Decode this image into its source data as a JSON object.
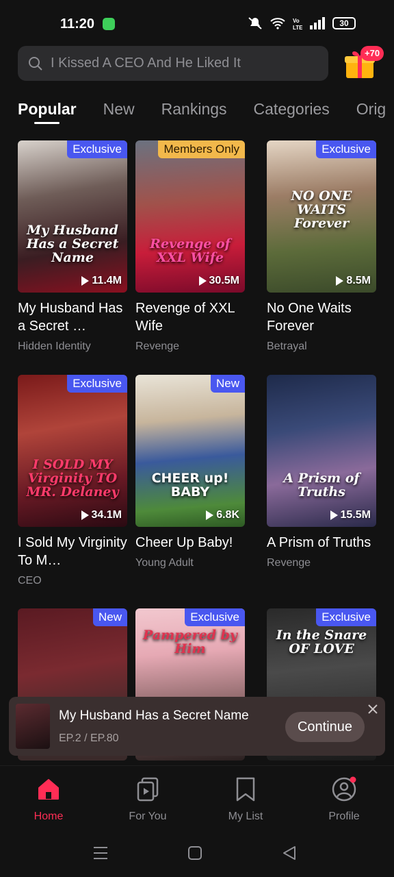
{
  "status": {
    "time": "11:20",
    "battery": "30"
  },
  "search": {
    "placeholder": "I Kissed A CEO And He Liked It"
  },
  "gift": {
    "badge": "+70"
  },
  "tabs": [
    {
      "label": "Popular"
    },
    {
      "label": "New"
    },
    {
      "label": "Rankings"
    },
    {
      "label": "Categories"
    },
    {
      "label": "Orig"
    }
  ],
  "cards": [
    {
      "title": "My Husband Has a Secret …",
      "genre": "Hidden Identity",
      "badge": "Exclusive",
      "views": "11.4M",
      "poster_text": "My Husband Has a Secret Name"
    },
    {
      "title": "Revenge of XXL Wife",
      "genre": "Revenge",
      "badge": "Members Only",
      "views": "30.5M",
      "poster_text": "Revenge of XXL Wife"
    },
    {
      "title": "No One Waits Forever",
      "genre": "Betrayal",
      "badge": "Exclusive",
      "views": "8.5M",
      "poster_text": "NO ONE WAITS Forever"
    },
    {
      "title": "I Sold My Virginity To M…",
      "genre": "CEO",
      "badge": "Exclusive",
      "views": "34.1M",
      "poster_text": "I SOLD MY Virginity TO MR. Delaney"
    },
    {
      "title": "Cheer Up Baby!",
      "genre": "Young Adult",
      "badge": "New",
      "views": "6.8K",
      "poster_text": "CHEER up! BABY"
    },
    {
      "title": "A Prism of Truths",
      "genre": "Revenge",
      "badge": "",
      "views": "15.5M",
      "poster_text": "A Prism of Truths"
    },
    {
      "title": "",
      "genre": "",
      "badge": "New",
      "views": "",
      "poster_text": ""
    },
    {
      "title": "",
      "genre": "",
      "badge": "Exclusive",
      "views": "",
      "poster_text": "Pampered by Him"
    },
    {
      "title": "",
      "genre": "",
      "badge": "Exclusive",
      "views": "",
      "poster_text": "In the Snare OF LOVE"
    }
  ],
  "continue": {
    "title": "My Husband Has a Secret Name",
    "episode": "EP.2 / EP.80",
    "button": "Continue"
  },
  "nav": [
    {
      "label": "Home"
    },
    {
      "label": "For You"
    },
    {
      "label": "My List"
    },
    {
      "label": "Profile"
    }
  ],
  "colors": {
    "accent": "#ff2d55",
    "badge_blue": "#4957f0",
    "badge_gold": "#f2b84b"
  }
}
